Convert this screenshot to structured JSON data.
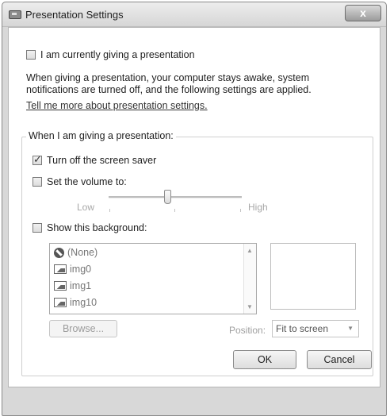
{
  "window": {
    "title": "Presentation Settings",
    "close_glyph": "x"
  },
  "giving_presentation": {
    "label": "I am currently giving a presentation",
    "checked": false
  },
  "description": "When giving a presentation, your computer stays awake, system notifications are turned off, and the following settings are applied.",
  "learn_more_link": "Tell me more about presentation settings.",
  "group": {
    "title": "When I am giving a presentation:",
    "screen_saver": {
      "label": "Turn off the screen saver",
      "checked": true
    },
    "volume": {
      "label": "Set the volume to:",
      "checked": false,
      "low_label": "Low",
      "high_label": "High",
      "level_fraction": 0.44
    },
    "background": {
      "label": "Show this background:",
      "checked": false,
      "items": [
        {
          "icon": "none-icon",
          "label": "(None)"
        },
        {
          "icon": "image-icon",
          "label": "img0"
        },
        {
          "icon": "image-icon",
          "label": "img1"
        },
        {
          "icon": "image-icon",
          "label": "img10"
        }
      ],
      "browse_label": "Browse...",
      "position_label": "Position:",
      "position_value": "Fit to screen"
    }
  },
  "buttons": {
    "ok": "OK",
    "cancel": "Cancel"
  }
}
